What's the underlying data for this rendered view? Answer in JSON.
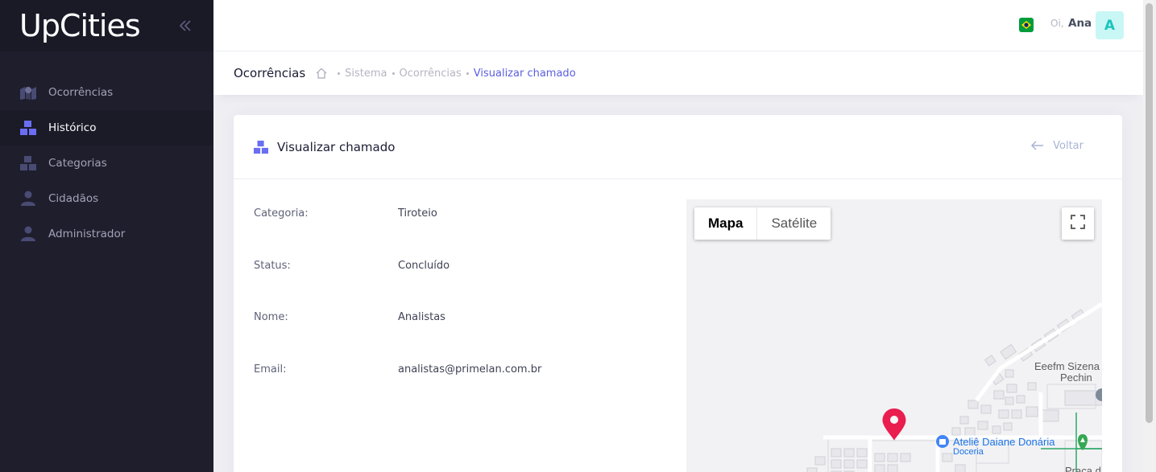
{
  "app": {
    "brand": "UpCities"
  },
  "sidebar": {
    "items": [
      {
        "label": "Ocorrências",
        "icon": "map-marker-icon",
        "active": false
      },
      {
        "label": "Histórico",
        "icon": "boxes-icon",
        "active": true
      },
      {
        "label": "Categorias",
        "icon": "boxes-icon",
        "active": false
      },
      {
        "label": "Cidadãos",
        "icon": "user-icon",
        "active": false
      },
      {
        "label": "Administrador",
        "icon": "user-icon",
        "active": false
      }
    ]
  },
  "header": {
    "greeting": "Oi,",
    "user": "Ana",
    "avatar_initial": "A",
    "language_flag": "brazil-flag-icon"
  },
  "subheader": {
    "title": "Ocorrências",
    "breadcrumb": [
      "Sistema",
      "Ocorrências",
      "Visualizar chamado"
    ]
  },
  "card": {
    "title": "Visualizar chamado",
    "back_label": "Voltar",
    "fields": [
      {
        "label": "Categoria:",
        "value": "Tiroteio"
      },
      {
        "label": "Status:",
        "value": "Concluído"
      },
      {
        "label": "Nome:",
        "value": "Analistas"
      },
      {
        "label": "Email:",
        "value": "analistas@primelan.com.br"
      }
    ]
  },
  "map": {
    "type_options": [
      "Mapa",
      "Satélite"
    ],
    "selected_type": "Mapa",
    "labels": {
      "school_line1": "Eeefm Sizena",
      "school_line2": "Pechin",
      "poi_name": "Ateliê Daiane Donária",
      "poi_category": "Doceria",
      "square": "Praça d"
    }
  },
  "colors": {
    "accent": "#5b5fde",
    "sidebar_bg": "#1e1e2d",
    "marker": "#ea1d4f",
    "avatar_bg": "#c9f7f5",
    "avatar_fg": "#1bc5bd"
  }
}
